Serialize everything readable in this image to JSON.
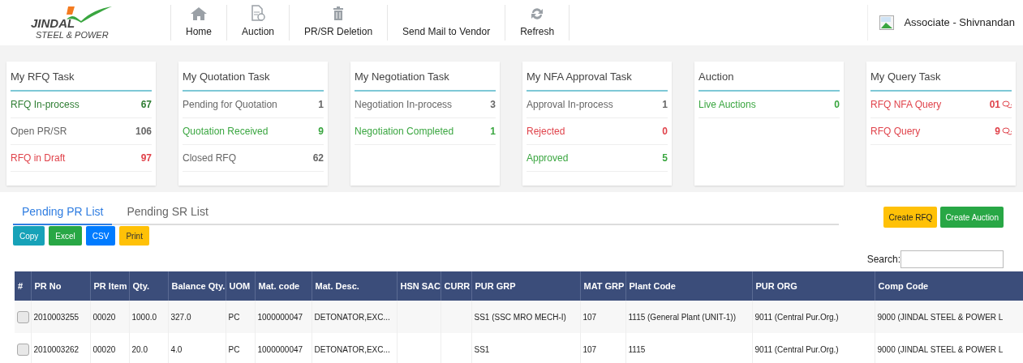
{
  "logo": {
    "name": "JINDAL",
    "tagline": "STEEL & POWER"
  },
  "nav": [
    {
      "label": "Home",
      "kind": "home"
    },
    {
      "label": "Auction",
      "kind": "doc"
    },
    {
      "label": "PR/SR Deletion",
      "kind": "trash"
    },
    {
      "label": "Send Mail to Vendor",
      "kind": "none"
    },
    {
      "label": "Refresh",
      "kind": "refresh"
    }
  ],
  "user": {
    "name": "Associate - Shivnandan"
  },
  "cards": [
    {
      "title": "My RFQ Task",
      "rows": [
        {
          "label": "RFQ In-process",
          "count": "67",
          "color": "#2e7d32"
        },
        {
          "label": "Open PR/SR",
          "count": "106",
          "color": "#666666"
        },
        {
          "label": "RFQ in Draft",
          "count": "97",
          "color": "#e0434b"
        }
      ]
    },
    {
      "title": "My Quotation Task",
      "rows": [
        {
          "label": "Pending for Quotation",
          "count": "1",
          "color": "#666666"
        },
        {
          "label": "Quotation Received",
          "count": "9",
          "color": "#3aa640"
        },
        {
          "label": "Closed RFQ",
          "count": "62",
          "color": "#666666"
        }
      ]
    },
    {
      "title": "My Negotiation Task",
      "rows": [
        {
          "label": "Negotiation In-process",
          "count": "3",
          "color": "#666666"
        },
        {
          "label": "Negotiation Completed",
          "count": "1",
          "color": "#3aa640"
        }
      ]
    },
    {
      "title": "My NFA Approval Task",
      "rows": [
        {
          "label": "Approval In-process",
          "count": "1",
          "color": "#666666"
        },
        {
          "label": "Rejected",
          "count": "0",
          "color": "#e0434b"
        },
        {
          "label": "Approved",
          "count": "5",
          "color": "#3aa640"
        }
      ]
    },
    {
      "title": "Auction",
      "rows": [
        {
          "label": "Live Auctions",
          "count": "0",
          "color": "#3aa640"
        }
      ]
    },
    {
      "title": "My Query Task",
      "rows": [
        {
          "label": "RFQ NFA Query",
          "count": "01",
          "color": "#e0434b",
          "chat": true
        },
        {
          "label": "RFQ Query",
          "count": "9",
          "color": "#e0434b",
          "chat": true
        }
      ]
    }
  ],
  "tabs": [
    {
      "label": "Pending PR List",
      "selected": true
    },
    {
      "label": "Pending SR List",
      "selected": false
    }
  ],
  "actions": [
    {
      "label": "Create RFQ",
      "color": "#ffc107"
    },
    {
      "label": "Create Auction",
      "color": "#28a745"
    }
  ],
  "exports": [
    {
      "label": "Copy",
      "color": "#17a2b8"
    },
    {
      "label": "Excel",
      "color": "#28a745"
    },
    {
      "label": "CSV",
      "color": "#007bff"
    },
    {
      "label": "Print",
      "color": "#ffc107"
    }
  ],
  "search": {
    "label": "Search:"
  },
  "table": {
    "columns": [
      "#",
      "PR No",
      "PR Item",
      "Qty.",
      "Balance Qty.",
      "UOM",
      "Mat. code",
      "Mat. Desc.",
      "HSN SAC",
      "CURR",
      "PUR GRP",
      "MAT GRP",
      "Plant Code",
      "PUR ORG",
      "Comp Code"
    ],
    "rows": [
      {
        "checked": false,
        "cells": [
          "",
          "2010003255",
          "00020",
          "1000.0",
          "327.0",
          "PC",
          "1000000047",
          "DETONATOR,EXC...",
          "",
          "",
          "SS1 (SSC MRO MECH-I)",
          "107",
          "1115 (General Plant (UNIT-1))",
          "9011 (Central Pur.Org.)",
          "9000 (JINDAL STEEL & POWER L"
        ]
      },
      {
        "checked": false,
        "cells": [
          "",
          "2010003262",
          "00020",
          "20.0",
          "4.0",
          "PC",
          "1000000047",
          "DETONATOR,EXC...",
          "",
          "",
          "SS1",
          "107",
          "1115",
          "9011 (Central Pur.Org.)",
          "9000 (JINDAL STEEL & POWER L"
        ]
      }
    ]
  }
}
